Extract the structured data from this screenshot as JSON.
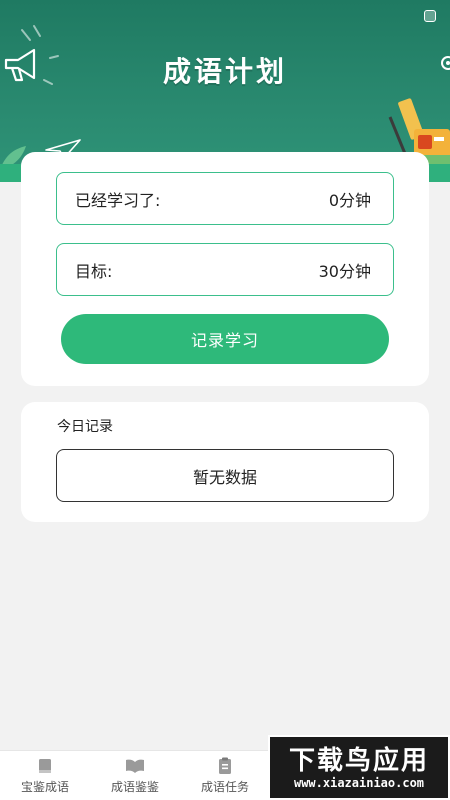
{
  "header": {
    "title": "成语计划"
  },
  "stats": {
    "learned_label": "已经学习了:",
    "learned_value": "0分钟",
    "goal_label": "目标:",
    "goal_value": "30分钟",
    "record_button": "记录学习"
  },
  "today": {
    "title": "今日记录",
    "empty_text": "暂无数据"
  },
  "tabs": [
    {
      "label": "宝鉴成语",
      "icon": "book-icon"
    },
    {
      "label": "成语鉴鉴",
      "icon": "open-book-icon"
    },
    {
      "label": "成语任务",
      "icon": "clipboard-icon"
    }
  ],
  "watermark": {
    "main": "下载鸟应用",
    "url": "www.xiazainiao.com"
  },
  "colors": {
    "header_green": "#1f7a62",
    "accent_green": "#2eb97a",
    "border_green": "#3bbf8c",
    "page_bg": "#f2f2f2"
  }
}
